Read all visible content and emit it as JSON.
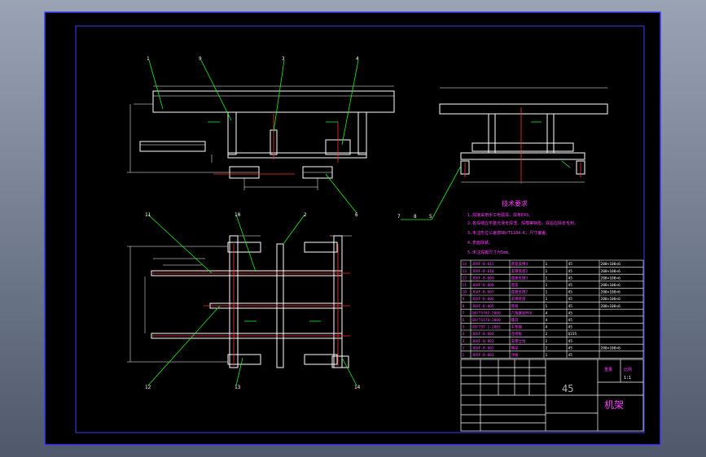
{
  "drawing": {
    "background": "#000000",
    "border_color": "#3b3bff",
    "line_color": "#ffffff",
    "leader_color": "#16f316",
    "centerline_color": "#ff3030",
    "dimension_color": "#ffffff",
    "note_color": "#ff3dff",
    "table_text_color": "#ff3dff"
  },
  "balloons": {
    "front": [
      "1",
      "9",
      "3",
      "4"
    ],
    "front_bottom": [
      "6"
    ],
    "side_bottom": [
      "7",
      "8",
      "5"
    ],
    "plan_top": [
      "11",
      "10",
      "2"
    ],
    "plan_bottom": [
      "12",
      "13",
      "14"
    ]
  },
  "notes": {
    "title": "技术要求",
    "items": [
      "1.焊接采用手工电弧焊，焊条E43。",
      "2.各焊缝应平整光滑无焊渣、焊瘤等缺陷，焊后应除去毛刺。",
      "3.未注形位公差按GB/T1184-K，尺寸偏差。",
      "4.表面除锈。",
      "5.未注焊脚尺寸为5mm。"
    ]
  },
  "bom": {
    "rows": [
      {
        "no": "14",
        "code": "JDXF-B-011",
        "name": "底座支撑4",
        "qty": "1",
        "mat": "45",
        "wt": "200×100×6"
      },
      {
        "no": "13",
        "code": "JDXF-B-010",
        "name": "支撑底座2",
        "qty": "1",
        "mat": "45",
        "wt": "200×100×6"
      },
      {
        "no": "12",
        "code": "JDXF-B-009",
        "name": "底座支撑3",
        "qty": "1",
        "mat": "45",
        "wt": "200×100×6"
      },
      {
        "no": "11",
        "code": "JDXF-B-008",
        "name": "底座",
        "qty": "1",
        "mat": "45",
        "wt": "200×100×6"
      },
      {
        "no": "10",
        "code": "JDXF-B-007",
        "name": "底座支撑2",
        "qty": "1",
        "mat": "45",
        "wt": "200×100×6"
      },
      {
        "no": "9",
        "code": "JDXF-B-006",
        "name": "支撑底座",
        "qty": "1",
        "mat": "45",
        "wt": "200×100×6"
      },
      {
        "no": "8",
        "code": "JDXF-B-005",
        "name": "底板",
        "qty": "1",
        "mat": "45",
        "wt": "200×100×6"
      },
      {
        "no": "7",
        "code": "GB/T5782-2000",
        "name": "六角螺栓M10",
        "qty": "4",
        "mat": "45",
        "wt": ""
      },
      {
        "no": "6",
        "code": "GB/T6170-2000",
        "name": "螺母",
        "qty": "4",
        "mat": "45",
        "wt": ""
      },
      {
        "no": "5",
        "code": "GB/T97.1-2002",
        "name": "平垫圈",
        "qty": "4",
        "mat": "45",
        "wt": ""
      },
      {
        "no": "4",
        "code": "JDXF-B-004",
        "name": "连接板",
        "qty": "2",
        "mat": "Q235",
        "wt": ""
      },
      {
        "no": "3",
        "code": "JDXF-B-003",
        "name": "支撑立柱",
        "qty": "2",
        "mat": "45",
        "wt": ""
      },
      {
        "no": "2",
        "code": "JDXF-B-002",
        "name": "横梁",
        "qty": "2",
        "mat": "45",
        "wt": "200×100×6"
      },
      {
        "no": "1",
        "code": "JDXF-B-001",
        "name": "顶板",
        "qty": "1",
        "mat": "45",
        "wt": ""
      }
    ]
  },
  "title_block": {
    "material": "45",
    "part_name": "机架",
    "scale_heads": [
      "重量",
      "比例"
    ],
    "scale_value": "1:1"
  }
}
